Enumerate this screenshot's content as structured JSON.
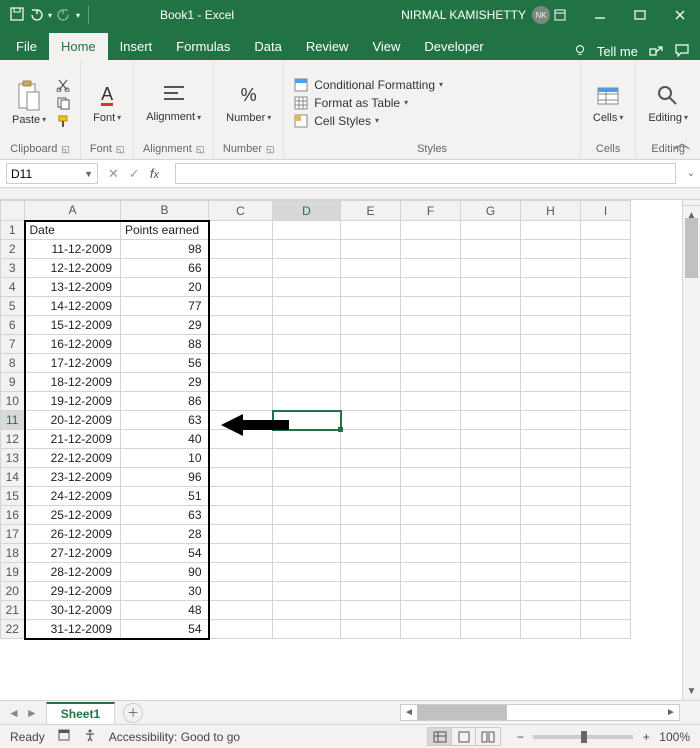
{
  "titlebar": {
    "title": "Book1 - Excel",
    "user_name": "NIRMAL KAMISHETTY",
    "user_initials": "NK"
  },
  "tabs": {
    "file": "File",
    "home": "Home",
    "insert": "Insert",
    "formulas": "Formulas",
    "data": "Data",
    "review": "Review",
    "view": "View",
    "developer": "Developer",
    "tell_me": "Tell me"
  },
  "ribbon": {
    "clipboard": {
      "paste": "Paste",
      "label": "Clipboard"
    },
    "font": {
      "btn": "Font",
      "label": "Font"
    },
    "alignment": {
      "btn": "Alignment",
      "label": "Alignment"
    },
    "number": {
      "btn": "Number",
      "label": "Number"
    },
    "styles": {
      "conditional": "Conditional Formatting",
      "table": "Format as Table",
      "cell": "Cell Styles",
      "label": "Styles"
    },
    "cells": {
      "btn": "Cells",
      "label": "Cells"
    },
    "editing": {
      "btn": "Editing",
      "label": "Editing"
    }
  },
  "namebox": {
    "value": "D11"
  },
  "columns": [
    "A",
    "B",
    "C",
    "D",
    "E",
    "F",
    "G",
    "H",
    "I"
  ],
  "headers": {
    "A": "Date",
    "B": "Points earned"
  },
  "rows": [
    {
      "n": 1
    },
    {
      "n": 2,
      "A": "11-12-2009",
      "B": "98"
    },
    {
      "n": 3,
      "A": "12-12-2009",
      "B": "66"
    },
    {
      "n": 4,
      "A": "13-12-2009",
      "B": "20"
    },
    {
      "n": 5,
      "A": "14-12-2009",
      "B": "77"
    },
    {
      "n": 6,
      "A": "15-12-2009",
      "B": "29"
    },
    {
      "n": 7,
      "A": "16-12-2009",
      "B": "88"
    },
    {
      "n": 8,
      "A": "17-12-2009",
      "B": "56"
    },
    {
      "n": 9,
      "A": "18-12-2009",
      "B": "29"
    },
    {
      "n": 10,
      "A": "19-12-2009",
      "B": "86"
    },
    {
      "n": 11,
      "A": "20-12-2009",
      "B": "63"
    },
    {
      "n": 12,
      "A": "21-12-2009",
      "B": "40"
    },
    {
      "n": 13,
      "A": "22-12-2009",
      "B": "10"
    },
    {
      "n": 14,
      "A": "23-12-2009",
      "B": "96"
    },
    {
      "n": 15,
      "A": "24-12-2009",
      "B": "51"
    },
    {
      "n": 16,
      "A": "25-12-2009",
      "B": "63"
    },
    {
      "n": 17,
      "A": "26-12-2009",
      "B": "28"
    },
    {
      "n": 18,
      "A": "27-12-2009",
      "B": "54"
    },
    {
      "n": 19,
      "A": "28-12-2009",
      "B": "90"
    },
    {
      "n": 20,
      "A": "29-12-2009",
      "B": "30"
    },
    {
      "n": 21,
      "A": "30-12-2009",
      "B": "48"
    },
    {
      "n": 22,
      "A": "31-12-2009",
      "B": "54"
    }
  ],
  "sheet": {
    "name": "Sheet1"
  },
  "status": {
    "ready": "Ready",
    "accessibility": "Accessibility: Good to go",
    "zoom": "100%"
  },
  "selected_cell": "D11"
}
